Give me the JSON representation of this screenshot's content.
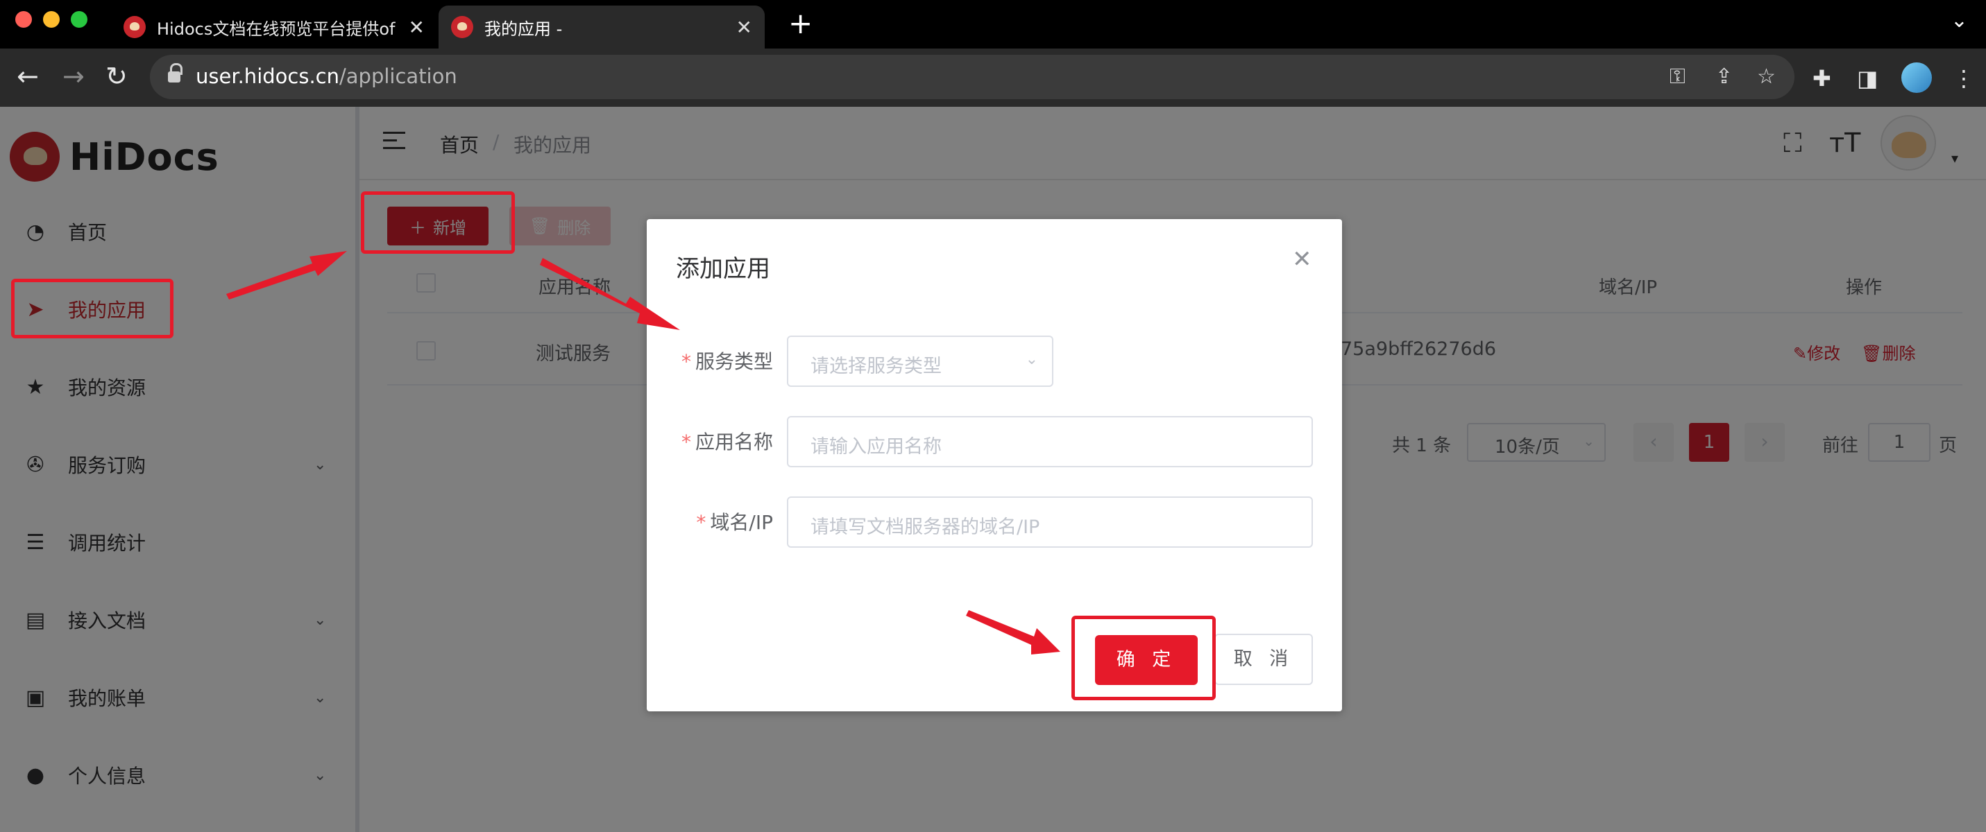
{
  "browser": {
    "tabs": [
      {
        "title": "Hidocs文档在线预览平台提供of",
        "active": false
      },
      {
        "title": "我的应用 -",
        "active": true
      }
    ],
    "new_tab": "+",
    "url_host": "user.hidocs.cn",
    "url_path": "/application",
    "icons": [
      "back-icon",
      "forward-icon",
      "reload-icon",
      "lock-icon",
      "key-icon",
      "share-icon",
      "star-icon",
      "extensions-icon",
      "sidepanel-icon",
      "profile-avatar",
      "more-icon"
    ]
  },
  "sidebar": {
    "logo_text": "HiDocs",
    "items": [
      {
        "label": "首页",
        "icon": "dashboard-icon",
        "active": false,
        "has_submenu": false
      },
      {
        "label": "我的应用",
        "icon": "send-icon",
        "active": true,
        "has_submenu": false
      },
      {
        "label": "我的资源",
        "icon": "star-icon",
        "active": false,
        "has_submenu": false
      },
      {
        "label": "服务订购",
        "icon": "aperture-icon",
        "active": false,
        "has_submenu": true
      },
      {
        "label": "调用统计",
        "icon": "list-icon",
        "active": false,
        "has_submenu": false
      },
      {
        "label": "接入文档",
        "icon": "document-icon",
        "active": false,
        "has_submenu": true
      },
      {
        "label": "我的账单",
        "icon": "picture-icon",
        "active": false,
        "has_submenu": true
      },
      {
        "label": "个人信息",
        "icon": "user-icon",
        "active": false,
        "has_submenu": true
      }
    ]
  },
  "header": {
    "breadcrumb": [
      "首页",
      "我的应用"
    ],
    "separator": "/"
  },
  "toolbar": {
    "add_label": "新增",
    "delete_label": "删除"
  },
  "table": {
    "columns": [
      "应用名称",
      "域名/IP",
      "操作"
    ],
    "rows": [
      {
        "name": "测试服务",
        "key_fragment": "75a9bff26276d6",
        "edit": "修改",
        "delete": "删除"
      }
    ]
  },
  "pagination": {
    "total": "共 1 条",
    "page_size": "10条/页",
    "current_page": "1",
    "goto_prefix": "前往",
    "goto_value": "1",
    "goto_suffix": "页"
  },
  "dialog": {
    "title": "添加应用",
    "fields": [
      {
        "label": "服务类型",
        "placeholder": "请选择服务类型",
        "type": "select",
        "required": true
      },
      {
        "label": "应用名称",
        "placeholder": "请输入应用名称",
        "type": "input",
        "required": true
      },
      {
        "label": "域名/IP",
        "placeholder": "请填写文档服务器的域名/IP",
        "type": "input",
        "required": true
      }
    ],
    "required_mark": "*",
    "confirm_label": "确 定",
    "cancel_label": "取 消"
  },
  "colors": {
    "brand": "#d71e2e",
    "annotation": "#e61a2a",
    "overlay": "rgba(0,0,0,0.5)"
  }
}
